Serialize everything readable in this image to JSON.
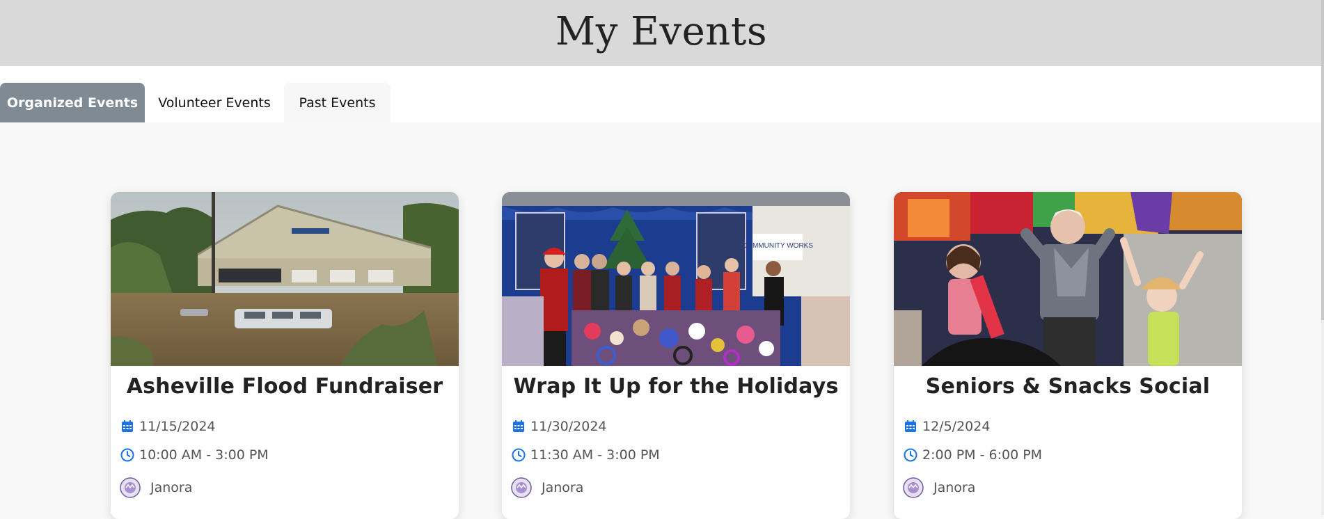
{
  "header": {
    "title": "My Events"
  },
  "tabs": [
    {
      "label": "Organized Events",
      "active": true
    },
    {
      "label": "Volunteer Events",
      "active": false
    },
    {
      "label": "Past Events",
      "active": false
    }
  ],
  "events": [
    {
      "title": "Asheville Flood Fundraiser",
      "date": "11/15/2024",
      "time": "10:00 AM - 3:00 PM",
      "organizer": "Janora",
      "image": "flooded-building-photo"
    },
    {
      "title": "Wrap It Up for the Holidays",
      "date": "11/30/2024",
      "time": "11:30 AM - 3:00 PM",
      "organizer": "Janora",
      "image": "holiday-toy-drive-group-photo",
      "image_sign": "COMMUNITY WORKS"
    },
    {
      "title": "Seniors & Snacks Social",
      "date": "12/5/2024",
      "time": "2:00 PM - 6:00 PM",
      "organizer": "Janora",
      "image": "seniors-and-children-photo"
    }
  ],
  "colors": {
    "header_bg": "#d9d9d9",
    "active_tab_bg": "#7f8a93",
    "icon_blue": "#1a73e8",
    "page_bg": "#f8f8f8"
  },
  "icons": {
    "date": "calendar-icon",
    "time": "clock-icon",
    "organizer": "avatar"
  }
}
